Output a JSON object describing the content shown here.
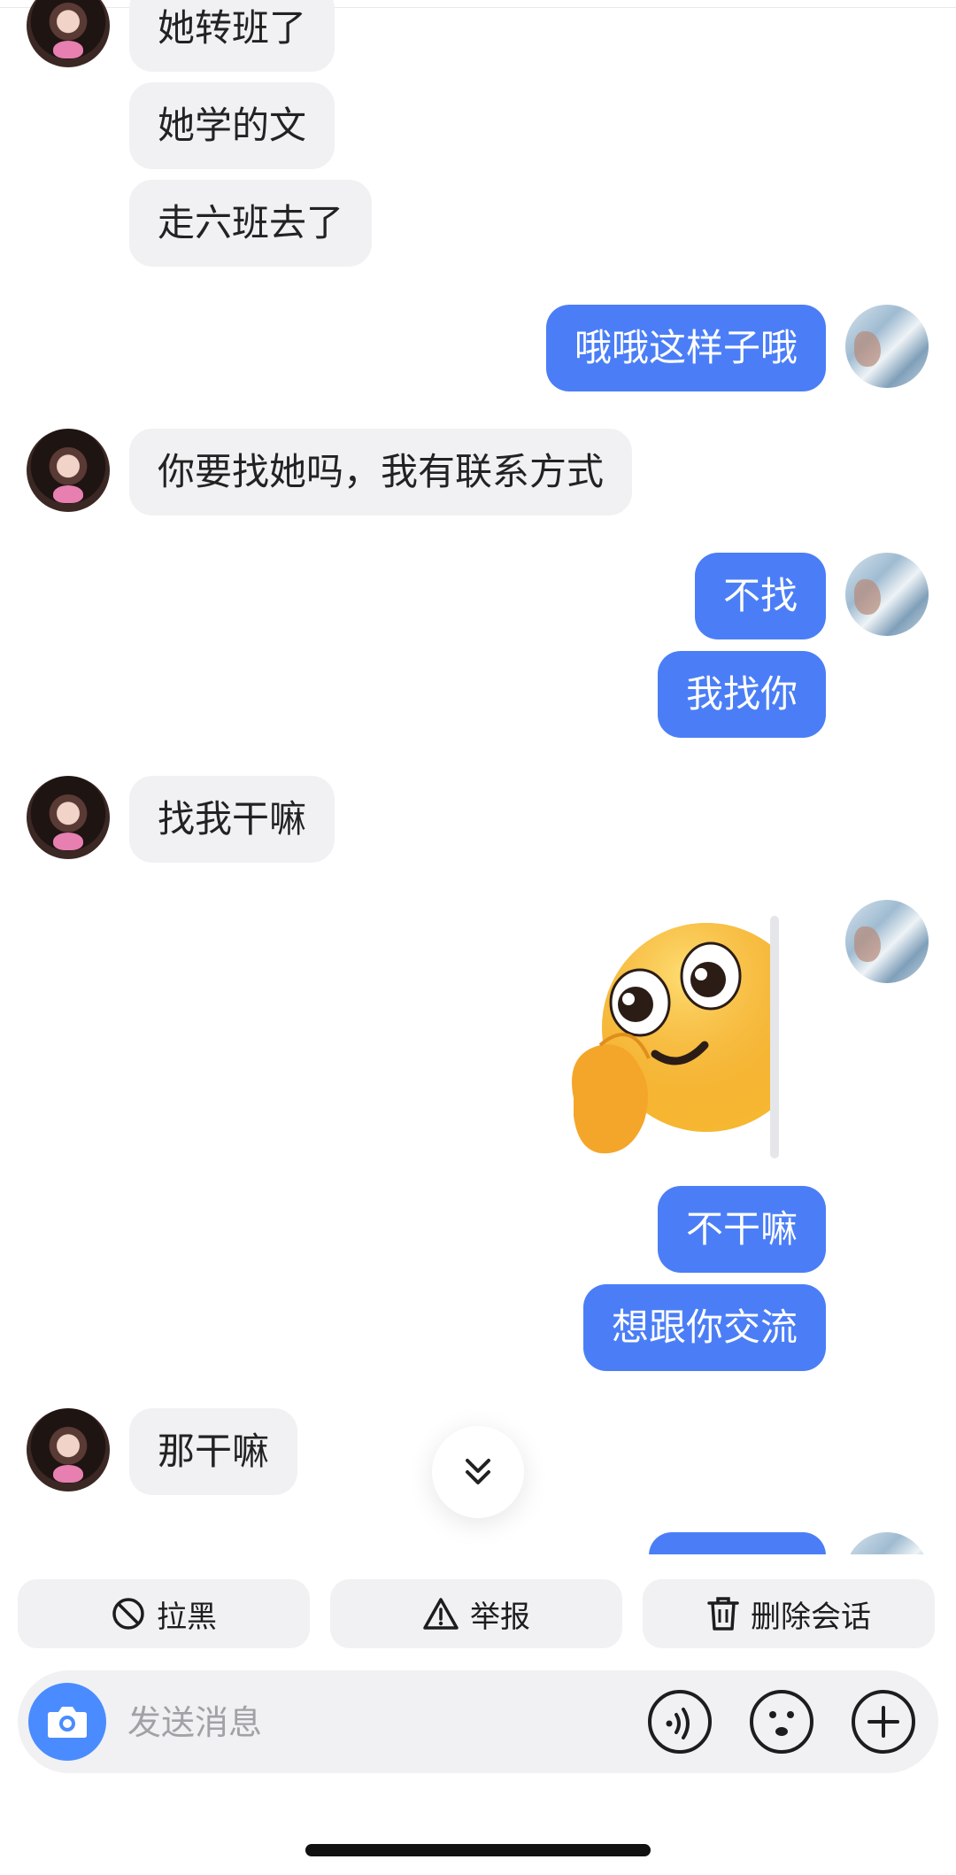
{
  "chat": {
    "messages": [
      {
        "side": "left",
        "text": "她转班了"
      },
      {
        "side": "left",
        "text": "她学的文"
      },
      {
        "side": "left",
        "text": "走六班去了"
      },
      {
        "side": "right",
        "text": "哦哦这样子哦"
      },
      {
        "side": "left",
        "text": "你要找她吗，我有联系方式"
      },
      {
        "side": "right",
        "text": "不找"
      },
      {
        "side": "right",
        "text": "我找你"
      },
      {
        "side": "left",
        "text": "找我干嘛"
      },
      {
        "side": "right",
        "sticker": "peeking-smiley-sticker"
      },
      {
        "side": "right",
        "text": "不干嘛"
      },
      {
        "side": "right",
        "text": "想跟你交流"
      },
      {
        "side": "left",
        "text": "那干嘛"
      }
    ]
  },
  "scroll_button": {
    "icon": "double-chevron-down-icon"
  },
  "actions": {
    "block_label": "拉黑",
    "report_label": "举报",
    "delete_label": "删除会话"
  },
  "input": {
    "placeholder": "发送消息",
    "value": ""
  },
  "icons": {
    "camera": "camera-icon",
    "voice": "voice-icon",
    "emoji": "emoji-icon",
    "plus": "plus-icon"
  },
  "colors": {
    "my_bubble": "#4b7ef6",
    "their_bubble": "#f1f1f3",
    "camera_button": "#4a8cff"
  }
}
